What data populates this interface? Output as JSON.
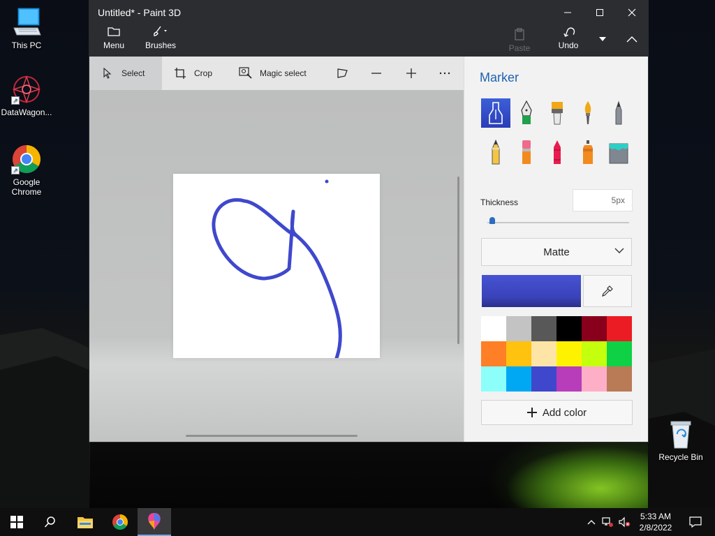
{
  "desktop": {
    "icons": [
      {
        "label": "This PC",
        "icon": "this-pc-icon"
      },
      {
        "label": "DataWagon...",
        "icon": "datawagon-icon"
      },
      {
        "label": "Google Chrome",
        "icon": "chrome-icon"
      },
      {
        "label": "Recycle Bin",
        "icon": "recycle-bin-icon"
      }
    ]
  },
  "window": {
    "title": "Untitled* - Paint 3D",
    "menu_label": "Menu",
    "brushes_label": "Brushes",
    "paste_label": "Paste",
    "undo_label": "Undo"
  },
  "toolbar": {
    "select_label": "Select",
    "crop_label": "Crop",
    "magic_select_label": "Magic select"
  },
  "panel": {
    "title": "Marker",
    "brushes": [
      "marker",
      "calligraphy-pen",
      "oil-brush",
      "watercolor",
      "pixel-pen",
      "pencil",
      "eraser",
      "crayon",
      "spray-can",
      "fill"
    ],
    "thickness_label": "Thickness",
    "thickness_value": "5px",
    "thickness_fraction": 0.02,
    "finish_value": "Matte",
    "current_color": "#4653d3",
    "palette": [
      "#ffffff",
      "#c3c3c3",
      "#585858",
      "#000000",
      "#88001b",
      "#ec1c24",
      "#ff7f27",
      "#ffc20e",
      "#ffe5a5",
      "#fff200",
      "#c4ff0e",
      "#0ed145",
      "#8cfffb",
      "#00a8f3",
      "#3f48cc",
      "#b83dba",
      "#ffaec8",
      "#b97a56"
    ],
    "add_color_label": "Add color"
  },
  "taskbar": {
    "time": "5:33 AM",
    "date": "2/8/2022"
  },
  "colors": {
    "accent": "#1f63b0",
    "stroke": "#3f48cc",
    "titlebar": "#2b2d31"
  }
}
